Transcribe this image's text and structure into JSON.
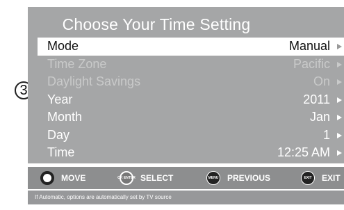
{
  "callout": {
    "number": "3"
  },
  "menu": {
    "title": "Choose Your Time Setting",
    "rows": [
      {
        "label": "Mode",
        "value": "Manual",
        "state": "selected"
      },
      {
        "label": "Time Zone",
        "value": "Pacific",
        "state": "disabled"
      },
      {
        "label": "Daylight Savings",
        "value": "On",
        "state": "disabled"
      },
      {
        "label": "Year",
        "value": "2011",
        "state": "normal"
      },
      {
        "label": "Month",
        "value": "Jan",
        "state": "normal"
      },
      {
        "label": "Day",
        "value": "1",
        "state": "normal"
      },
      {
        "label": "Time",
        "value": "12:25 AM",
        "state": "normal"
      }
    ]
  },
  "nav": {
    "move": {
      "label": "MOVE",
      "icon": "dpad-icon"
    },
    "select": {
      "label": "SELECT",
      "icon": "ok-enter-icon",
      "icon_text": "OK ENTER"
    },
    "previous": {
      "label": "PREVIOUS",
      "icon": "menu-button-icon",
      "icon_text": "MENU"
    },
    "exit": {
      "label": "EXIT",
      "icon": "exit-button-icon",
      "icon_text": "EXIT"
    }
  },
  "hint": "If Automatic, options are automatically set by TV source",
  "colors": {
    "panel": "#a5a6a7",
    "nav_bar": "#8d8e8f",
    "selected_row": "#ffffff",
    "disabled_text": "#c9caca"
  }
}
